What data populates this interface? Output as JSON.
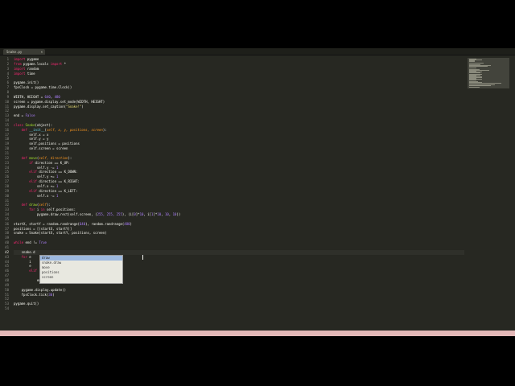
{
  "editor": {
    "tab": {
      "filename": "Snake.py",
      "close": "×"
    },
    "status": "",
    "active_line": "42",
    "line_numbers": [
      "1",
      "2",
      "3",
      "4",
      "5",
      "6",
      "7",
      "8",
      "9",
      "10",
      "11",
      "12",
      "13",
      "14",
      "15",
      "16",
      "17",
      "18",
      "19",
      "20",
      "21",
      "22",
      "23",
      "24",
      "25",
      "26",
      "27",
      "28",
      "29",
      "30",
      "31",
      "32",
      "33",
      "34",
      "35",
      "36",
      "37",
      "38",
      "39",
      "40",
      "41",
      "42",
      "43",
      "44",
      "45",
      "46",
      "47",
      "48",
      "49",
      "50",
      "51",
      "52",
      "53",
      "54"
    ],
    "code": {
      "l1a": "import",
      "l1b": " pygame",
      "l2a": "from",
      "l2b": " pygame.locals ",
      "l2c": "import",
      "l2d": " *",
      "l3a": "import",
      "l3b": " random",
      "l4a": "import",
      "l4b": " time",
      "l6": "pygame.init()",
      "l7": "fpsClock = pygame.time.Clock()",
      "l9a": "WIDTH, HEIGHT = ",
      "l9b": "640",
      "l9c": ", ",
      "l9d": "480",
      "l10": "screen = pygame.display.set_mode(WIDTH, HEIGHT)",
      "l11a": "pygame.display.set_caption(",
      "l11b": "\"Snake!\"",
      "l11c": ")",
      "l13a": "end = ",
      "l13b": "False",
      "l15a": "class",
      "l15b": " Snake",
      "l15c": "(object):",
      "l16a": "    def",
      "l16b": " __init__",
      "l16c": "(",
      "l16d": "self, x, y, positions, screen",
      "l16e": "):",
      "l17": "        self.x = x",
      "l18": "        self.y = y",
      "l19": "        self.positions = positions",
      "l20": "        self.screen = screen",
      "l22a": "    def",
      "l22b": " move",
      "l22c": "(",
      "l22d": "self, direction",
      "l22e": "):",
      "l23a": "        if",
      "l23b": " direction == K_UP:",
      "l24a": "            self.y -= ",
      "l24b": "1",
      "l25a": "        elif",
      "l25b": " direction == K_DOWN:",
      "l26a": "            self.y += ",
      "l26b": "1",
      "l27a": "        elif",
      "l27b": " direction == K_RIGHT:",
      "l28a": "            self.x += ",
      "l28b": "1",
      "l29a": "        elif",
      "l29b": " direction == K_LEFT:",
      "l30a": "            self.x -= ",
      "l30b": "1",
      "l32a": "    def",
      "l32b": " draw",
      "l32c": "(",
      "l32d": "self",
      "l32e": "):",
      "l33a": "        for",
      "l33b": " i ",
      "l33c": "in",
      "l33d": " self.positions:",
      "l34a": "            pygame.draw.rect(self.screen, (",
      "l34b": "255, 255, 255",
      "l34c": "), (i[",
      "l34d": "0",
      "l34e": "]*",
      "l34f": "10",
      "l34g": ", i[",
      "l34h": "1",
      "l34i": "]*",
      "l34j": "10",
      "l34k": ", ",
      "l34l": "10",
      "l34m": ", ",
      "l34n": "10",
      "l34o": "))",
      "l36a": "startX, startY = random.randrange(",
      "l36b": "640",
      "l36c": "), random.randrange(",
      "l36d": "480",
      "l36e": ")",
      "l37": "positions = [(startX, startY)]",
      "l38": "snake = Snake(startX, startY, positions, screen)",
      "l40a": "while",
      "l40b": " end != ",
      "l40c": "True",
      "l42": "    snake.d",
      "l43a": "    for",
      "l43b": " e",
      "l44": "        i",
      "l45": "        e",
      "l46a": "        elif",
      "l48a": "            end = ",
      "l48b": "True",
      "l50": "    pygame.display.update()",
      "l51a": "    fpsClock.tick(",
      "l51b": "30",
      "l51c": ")",
      "l53": "pygame.quit()"
    },
    "autocomplete": [
      "draw",
      "snake.draw",
      "move",
      "positions",
      "screen"
    ]
  }
}
